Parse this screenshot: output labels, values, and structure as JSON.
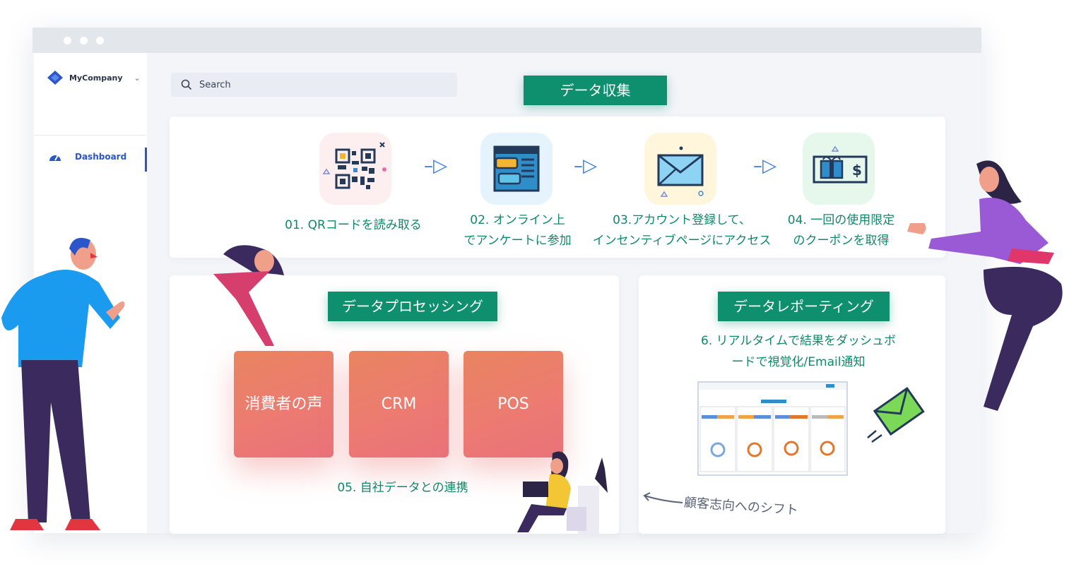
{
  "app": {
    "company_name": "MyCompany",
    "nav_dashboard": "Dashboard",
    "search_placeholder": "Search"
  },
  "collection": {
    "title": "データ収集",
    "steps": [
      {
        "line1": "01. QRコードを読み取る",
        "line2": "",
        "icon": "qr-code-icon",
        "bg": "#fdeef0"
      },
      {
        "line1": "02. オンライン上",
        "line2": "でアンケートに参加",
        "icon": "survey-chat-icon",
        "bg": "#e4f3fc"
      },
      {
        "line1": "03.アカウント登録して、",
        "line2": "インセンティブページにアクセス",
        "icon": "envelope-icon",
        "bg": "#fff6dc"
      },
      {
        "line1": "04. 一回の使用限定",
        "line2": "のクーポンを取得",
        "icon": "gift-coupon-icon",
        "bg": "#e6f8ec"
      }
    ]
  },
  "processing": {
    "title": "データプロセッシング",
    "tiles": [
      "消費者の声",
      "CRM",
      "POS"
    ],
    "caption": "05. 自社データとの連携"
  },
  "reporting": {
    "title": "データレポーティング",
    "caption_line1": "6. リアルタイムで結果をダッシュボ",
    "caption_line2": "ードで視覚化/Email通知"
  },
  "annotation": {
    "shift": "顧客志向へのシフト"
  },
  "colors": {
    "accent_green": "#0e8f6e",
    "text_green": "#10896a",
    "tile_coral": "#ec7a72",
    "nav_blue": "#2b56c9"
  }
}
